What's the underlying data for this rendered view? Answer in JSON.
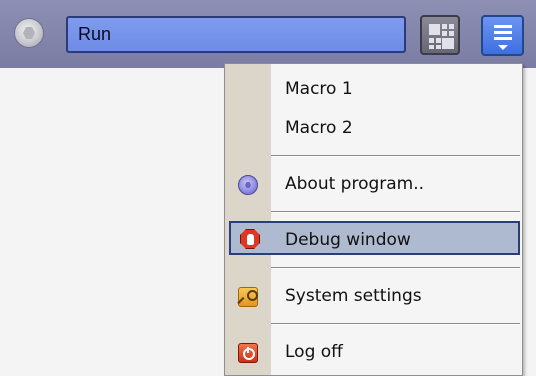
{
  "toolbar": {
    "run_value": "Run",
    "app_icon": "app-logo-icon",
    "grid_icon": "grid-view-icon",
    "menu_icon": "menu-icon"
  },
  "menu": {
    "items": [
      {
        "label": "Macro 1"
      },
      {
        "label": "Macro 2"
      },
      {
        "label": "About program..",
        "icon": "about-icon"
      },
      {
        "label": "Debug window",
        "icon": "debug-stop-icon",
        "highlighted": true
      },
      {
        "label": "System settings",
        "icon": "key-icon"
      },
      {
        "label": "Log off",
        "icon": "power-icon"
      }
    ]
  },
  "colors": {
    "toolbar": "#8586ad",
    "run_field": "#7893eb",
    "highlight": "#aebacf",
    "gutter": "#dbd6c9"
  }
}
